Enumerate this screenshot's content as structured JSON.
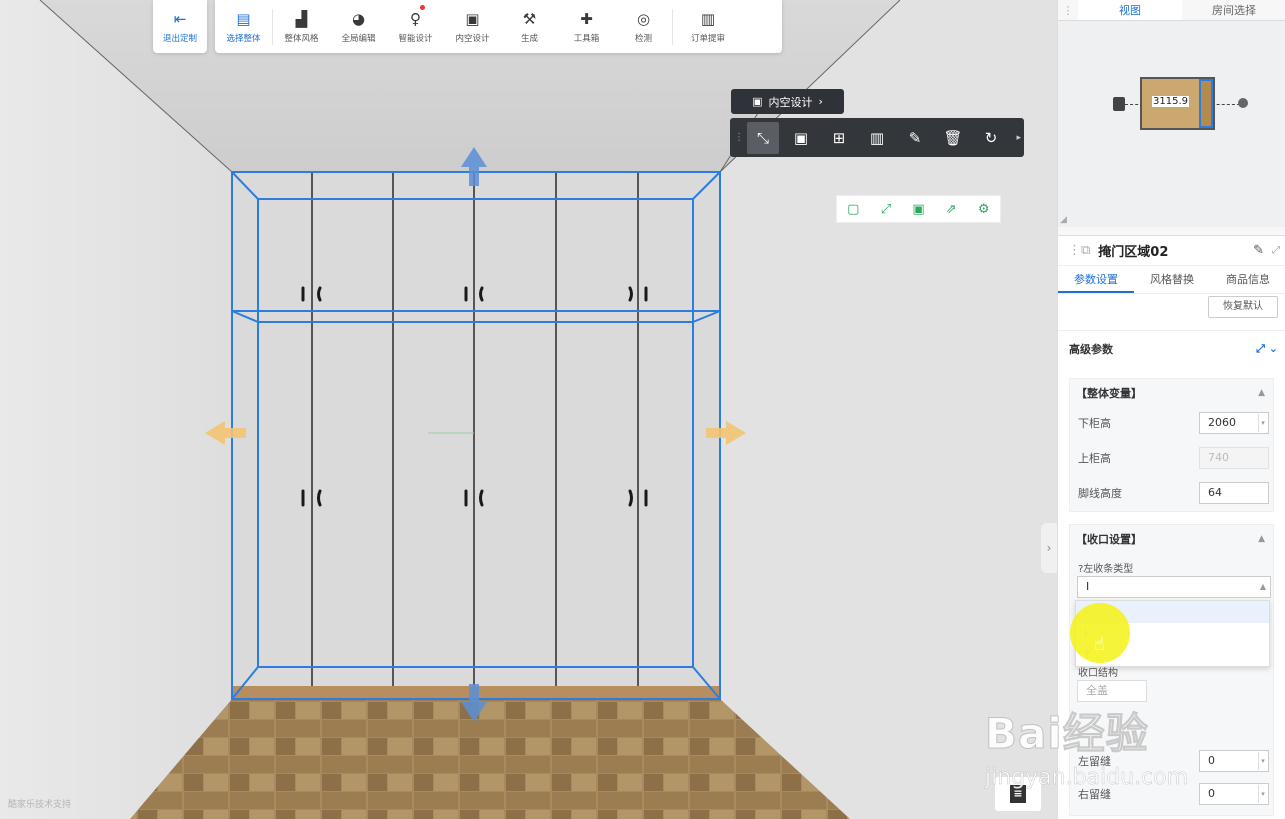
{
  "toolbar": {
    "exit": {
      "icon": "exit-icon",
      "label": "退出定制"
    },
    "items": [
      {
        "name": "select-all",
        "icon": "select-icon",
        "label": "选择整体",
        "active": true
      },
      {
        "name": "overall-style",
        "icon": "paint-roller-icon",
        "label": "整体风格"
      },
      {
        "name": "global-edit",
        "icon": "palette-icon",
        "label": "全局编辑"
      },
      {
        "name": "smart-design",
        "icon": "bulb-icon",
        "label": "智能设计",
        "dot": true
      },
      {
        "name": "interior-design",
        "icon": "frame-icon",
        "label": "内空设计"
      },
      {
        "name": "generate",
        "icon": "hammer-icon",
        "label": "生成"
      },
      {
        "name": "toolbox",
        "icon": "puzzle-icon",
        "label": "工具箱"
      },
      {
        "name": "check",
        "icon": "target-icon",
        "label": "检测"
      }
    ],
    "order": {
      "icon": "clipboard-icon",
      "label": "订单提审"
    }
  },
  "context": {
    "title": "内空设计",
    "tools": [
      "scale-icon",
      "frame-select-icon",
      "add-copy-icon",
      "door-split-icon",
      "brush-icon",
      "trash-icon",
      "rotate-2d-icon"
    ]
  },
  "scene": {
    "credit": "酷家乐技术支持"
  },
  "view_panel": {
    "tabs": [
      "视图",
      "房间选择"
    ],
    "dimension": "3115.9"
  },
  "prop_panel": {
    "title": "掩门区域02",
    "tabs": [
      "参数设置",
      "风格替换",
      "商品信息"
    ],
    "restore": "恢复默认",
    "advanced": "高级参数",
    "group1": {
      "title": "【整体变量】",
      "rows": [
        {
          "label": "下柜高",
          "value": "2060"
        },
        {
          "label": "上柜高",
          "value": "740"
        },
        {
          "label": "脚线高度",
          "value": "64"
        }
      ]
    },
    "group2": {
      "title": "【收口设置】",
      "left_type_label": "?左收条类型",
      "left_type_value": "I",
      "options": [
        "I",
        "L",
        "T"
      ],
      "structure_label": "收口结构",
      "structure_value": "全盖",
      "rows": [
        {
          "label": "左留缝",
          "value": "0"
        },
        {
          "label": "右留缝",
          "value": "0"
        }
      ]
    }
  },
  "watermark": {
    "brand": "Bai经验",
    "url": "jingyan.baidu.com"
  }
}
